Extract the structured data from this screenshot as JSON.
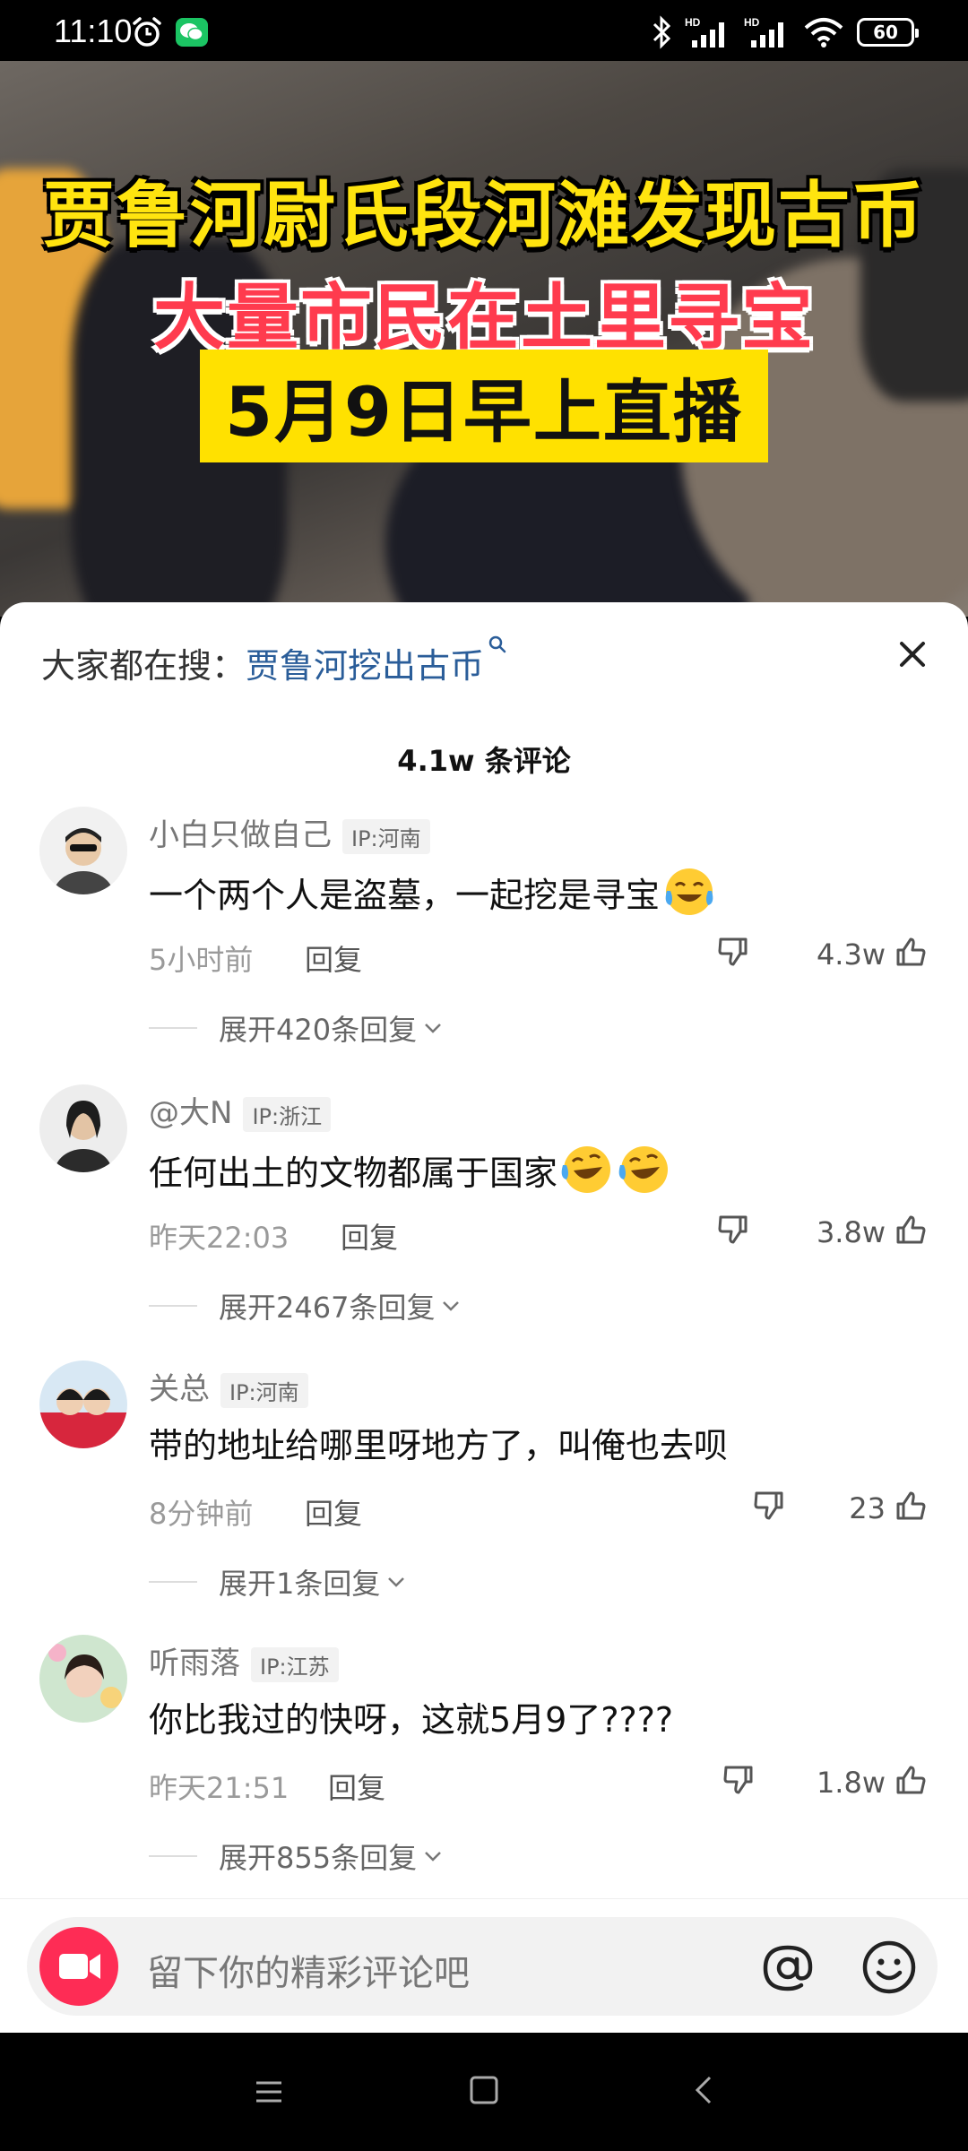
{
  "status_bar": {
    "time": "11:10",
    "battery": "60",
    "icons": [
      "alarm-icon",
      "wechat-icon",
      "bluetooth-icon",
      "signal-hd-icon",
      "signal-hd-icon",
      "wifi-icon",
      "battery-icon"
    ]
  },
  "video": {
    "caption_line1": "贾鲁河尉氏段河滩发现古币",
    "caption_line2": "大量市民在土里寻宝",
    "caption_line3": "5月9日早上直播"
  },
  "sheet": {
    "search_prefix": "大家都在搜：",
    "search_term": "贾鲁河挖出古币",
    "comment_count": "4.1w 条评论"
  },
  "comments": [
    {
      "name": "小白只做自己",
      "ip": "IP:河南",
      "text": "一个两个人是盗墓，一起挖是寻宝",
      "emojis": [
        "crying-laughing-emoji"
      ],
      "time": "5小时前",
      "reply": "回复",
      "likes": "4.3w",
      "expand": "展开420条回复"
    },
    {
      "name": "@大N",
      "ip": "IP:浙江",
      "text": "任何出土的文物都属于国家",
      "emojis": [
        "rofl-emoji",
        "rofl-emoji"
      ],
      "time": "昨天22:03",
      "reply": "回复",
      "likes": "3.8w",
      "expand": "展开2467条回复"
    },
    {
      "name": "关总",
      "ip": "IP:河南",
      "text": "带的地址给哪里呀地方了，叫俺也去呗",
      "emojis": [],
      "time": "8分钟前",
      "reply": "回复",
      "likes": "23",
      "expand": "展开1条回复"
    },
    {
      "name": "听雨落",
      "ip": "IP:江苏",
      "text": "你比我过的快呀，这就5月9了????",
      "emojis": [],
      "time": "昨天21:51",
      "reply": "回复",
      "likes": "1.8w",
      "expand": "展开855条回复"
    }
  ],
  "input": {
    "placeholder": "留下你的精彩评论吧"
  },
  "colors": {
    "accent": "#fe2c55",
    "search_link": "#2a5d99",
    "caption_yellow": "#ffe40f",
    "caption_red": "#ff3b4e"
  }
}
